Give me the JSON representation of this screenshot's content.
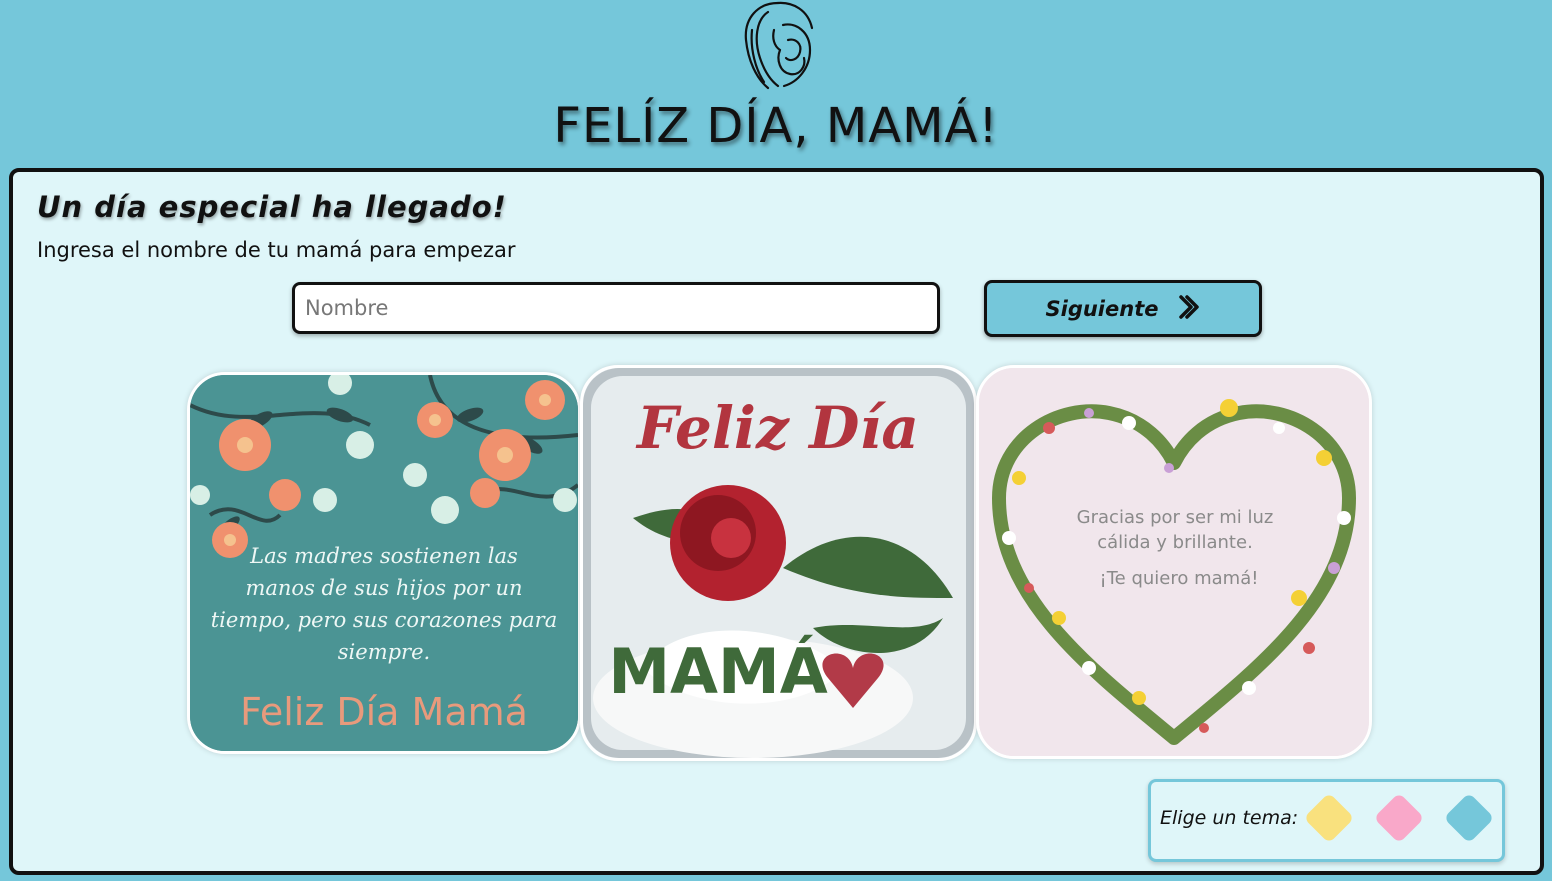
{
  "header": {
    "title": "FELÍZ DÍA, MAMÁ!"
  },
  "panel": {
    "heading": "Un día especial ha llegado!",
    "subtitle": "Ingresa el nombre de tu mamá para empezar",
    "name_input": {
      "placeholder": "Nombre",
      "value": ""
    },
    "next_button": {
      "label": "Siguiente",
      "icon": "chevron-right-icon"
    }
  },
  "cards": [
    {
      "name": "card-flowers-quote",
      "quote_lines": [
        "Las madres sostienen las",
        "manos de sus hijos por un",
        "tiempo, pero sus corazones para",
        "siempre."
      ],
      "footer": "Feliz Día Mamá"
    },
    {
      "name": "card-rose",
      "title": "Feliz Día",
      "word": "MAMÁ"
    },
    {
      "name": "card-heart-wreath",
      "lines": [
        "Gracias por ser mi luz",
        "cálida y brillante."
      ],
      "closing": "¡Te quiero mamá!"
    }
  ],
  "theme_picker": {
    "label": "Elige un tema:",
    "swatches": [
      {
        "name": "yellow",
        "color": "#f9e17e"
      },
      {
        "name": "pink",
        "color": "#f9a8c9"
      },
      {
        "name": "blue",
        "color": "#75c7da"
      }
    ]
  },
  "colors": {
    "background": "#75c7da",
    "panel": "#dff6f9",
    "accent": "#75c7da"
  }
}
